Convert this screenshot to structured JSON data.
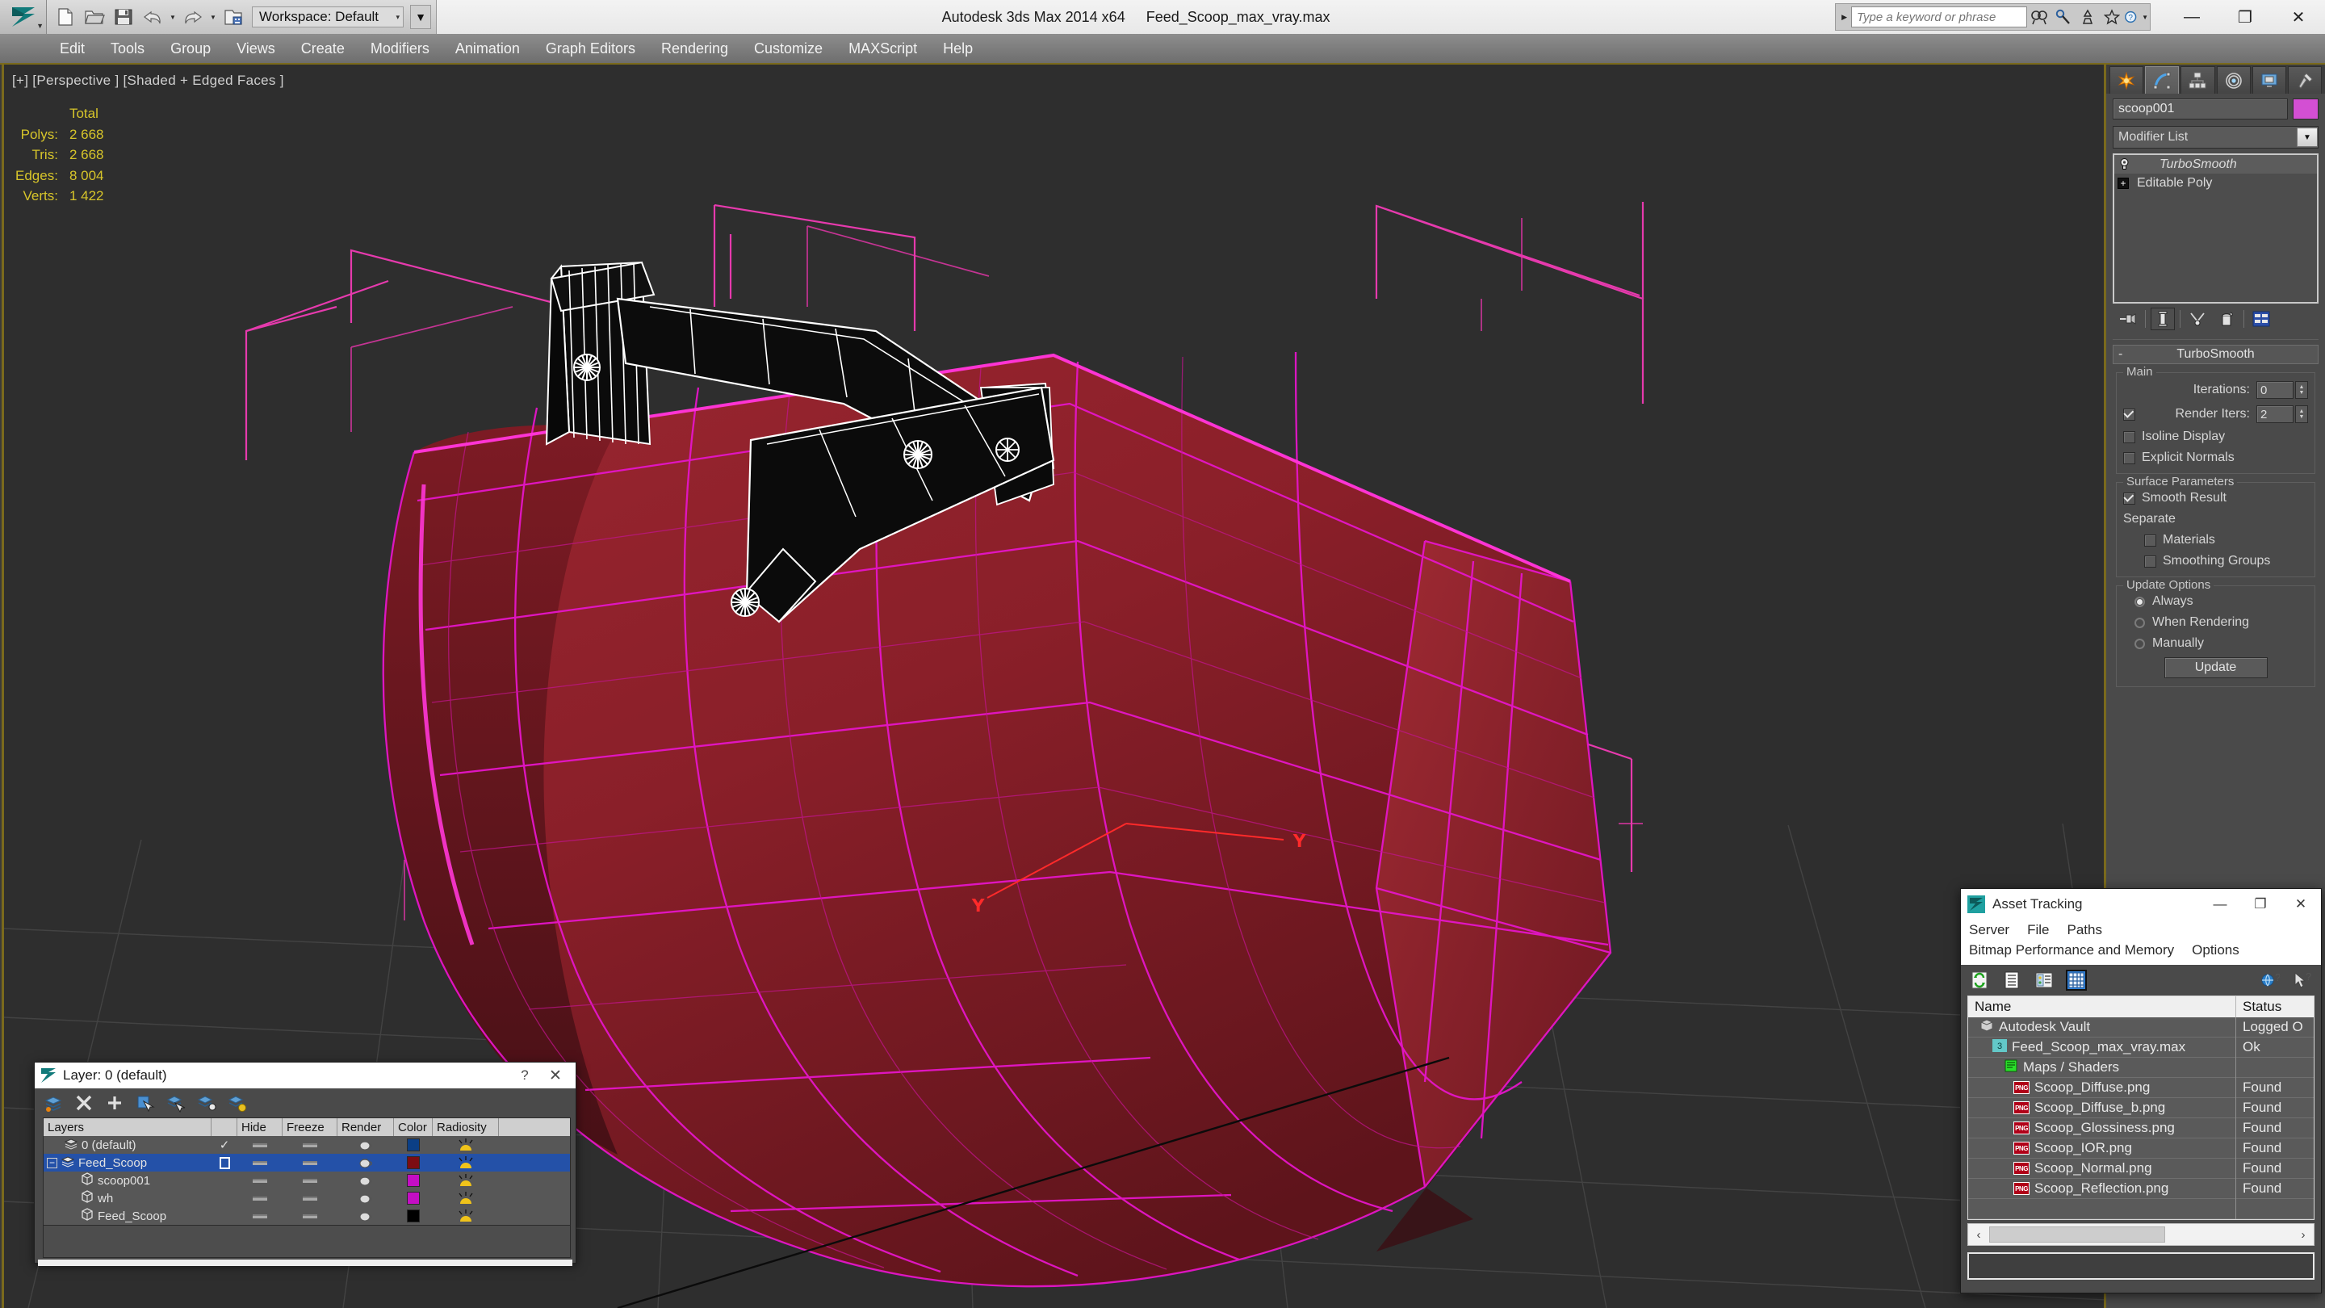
{
  "titlebar": {
    "app_title": "Autodesk 3ds Max  2014 x64",
    "file_title": "Feed_Scoop_max_vray.max",
    "workspace_label": "Workspace: Default",
    "workspace_caret": "▾",
    "qat_more": "▼",
    "quick_access": [
      {
        "name": "new-file-icon",
        "label": "New"
      },
      {
        "name": "open-file-icon",
        "label": "Open"
      },
      {
        "name": "save-file-icon",
        "label": "Save"
      },
      {
        "name": "undo-icon",
        "label": "Undo"
      },
      {
        "name": "redo-icon",
        "label": "Redo"
      },
      {
        "name": "set-project-folder-icon",
        "label": "Set Project Folder"
      }
    ],
    "search_placeholder": "Type a keyword or phrase",
    "infocenter_icons": [
      "search-icon",
      "subscription-center-icon",
      "communication-center-icon",
      "favorites-icon",
      "help-icon"
    ],
    "window_controls": {
      "minimize": "—",
      "maximize": "❐",
      "close": "✕"
    }
  },
  "menubar": {
    "items": [
      "Edit",
      "Tools",
      "Group",
      "Views",
      "Create",
      "Modifiers",
      "Animation",
      "Graph Editors",
      "Rendering",
      "Customize",
      "MAXScript",
      "Help"
    ]
  },
  "viewport": {
    "label": "[+] [Perspective ] [Shaded + Edged Faces ]",
    "stats_header": "Total",
    "stats": [
      {
        "label": "Polys:",
        "value": "2 668"
      },
      {
        "label": "Tris:",
        "value": "2 668"
      },
      {
        "label": "Edges:",
        "value": "8 004"
      },
      {
        "label": "Verts:",
        "value": "1 422"
      }
    ],
    "colors": {
      "background": "#2e2e2e",
      "mesh_fill": "#8c1f28",
      "mesh_edge": "#e614c8",
      "selection_bracket": "#ff2fbd",
      "gizmo_x": "#ff2020",
      "grid": "#4a4a4a",
      "wire_white": "#ffffff",
      "stats_text": "#d7c52a"
    }
  },
  "command_panel": {
    "tabs": [
      {
        "name": "create-tab",
        "icon": "star-icon",
        "active": false
      },
      {
        "name": "modify-tab",
        "icon": "curve-icon",
        "active": true
      },
      {
        "name": "hierarchy-tab",
        "icon": "hierarchy-icon",
        "active": false
      },
      {
        "name": "motion-tab",
        "icon": "motion-icon",
        "active": false
      },
      {
        "name": "display-tab",
        "icon": "display-icon",
        "active": false
      },
      {
        "name": "utilities-tab",
        "icon": "hammer-icon",
        "active": false
      }
    ],
    "object_name": "scoop001",
    "object_color": "#d34fd3",
    "modifier_list_label": "Modifier List",
    "stack": [
      {
        "label": "TurboSmooth",
        "selected": true,
        "italic": true
      },
      {
        "label": "Editable Poly",
        "selected": false,
        "italic": false
      }
    ],
    "stack_buttons": [
      {
        "name": "pin-stack-button",
        "icon": "pin-icon",
        "active": false
      },
      {
        "name": "show-end-result-button",
        "icon": "show-end-result-icon",
        "active": true
      },
      {
        "name": "make-unique-button",
        "icon": "make-unique-icon",
        "active": false
      },
      {
        "name": "remove-modifier-button",
        "icon": "trash-icon",
        "active": false
      },
      {
        "name": "configure-modifier-sets-button",
        "icon": "configure-sets-icon",
        "active": false
      }
    ],
    "rollout": {
      "title": "TurboSmooth",
      "collapse_glyph": "-",
      "main_group": "Main",
      "iterations_label": "Iterations:",
      "iterations_value": "0",
      "render_iters_label": "Render Iters:",
      "render_iters_value": "2",
      "render_iters_checked": true,
      "isoline_label": "Isoline Display",
      "isoline_checked": false,
      "explicit_normals_label": "Explicit Normals",
      "explicit_normals_checked": false,
      "surface_group": "Surface Parameters",
      "smooth_result_label": "Smooth Result",
      "smooth_result_checked": true,
      "separate_label": "Separate",
      "materials_label": "Materials",
      "materials_checked": false,
      "smoothing_groups_label": "Smoothing Groups",
      "smoothing_groups_checked": false,
      "update_group": "Update Options",
      "update_always": "Always",
      "update_when_rendering": "When Rendering",
      "update_manually": "Manually",
      "update_selected": "Always",
      "update_button": "Update"
    }
  },
  "layer_dialog": {
    "title": "Layer: 0 (default)",
    "help_glyph": "?",
    "close_glyph": "✕",
    "toolbar": [
      {
        "name": "create-new-layer-button",
        "icon": "new-layer-icon"
      },
      {
        "name": "delete-layer-button",
        "icon": "delete-x-icon"
      },
      {
        "name": "add-selection-button",
        "icon": "plus-icon"
      },
      {
        "name": "select-objects-in-layer-button",
        "icon": "select-objects-icon"
      },
      {
        "name": "select-highlighted-button",
        "icon": "select-highlighted-icon"
      },
      {
        "name": "highlight-selected-button",
        "icon": "highlight-selected-icon"
      },
      {
        "name": "layer-properties-button",
        "icon": "layer-properties-icon"
      }
    ],
    "columns": [
      "Layers",
      "",
      "Hide",
      "Freeze",
      "Render",
      "Color",
      "Radiosity",
      ""
    ],
    "rows": [
      {
        "name": "0 (default)",
        "type": "layer",
        "indent": 1,
        "current": true,
        "selected": false,
        "hide": "dash",
        "freeze": "dash",
        "render": "teapot",
        "color": "#0b3f86",
        "radiosity": "lamp"
      },
      {
        "name": "Feed_Scoop",
        "type": "layer",
        "indent": 0,
        "current": false,
        "selected": true,
        "expand": "-",
        "hide": "dash",
        "freeze": "dash",
        "render": "teapot",
        "color": "#7c0d12",
        "radiosity": "lamp"
      },
      {
        "name": "scoop001",
        "type": "object",
        "indent": 2,
        "current": false,
        "selected": false,
        "hide": "dash",
        "freeze": "dash",
        "render": "teapot",
        "color": "#c40ec4",
        "radiosity": "lamp"
      },
      {
        "name": "wh",
        "type": "object",
        "indent": 2,
        "current": false,
        "selected": false,
        "hide": "dash",
        "freeze": "dash",
        "render": "teapot",
        "color": "#c40ec4",
        "radiosity": "lamp"
      },
      {
        "name": "Feed_Scoop",
        "type": "object",
        "indent": 2,
        "current": false,
        "selected": false,
        "hide": "dash",
        "freeze": "dash",
        "render": "teapot",
        "color": "#000000",
        "radiosity": "lamp"
      }
    ]
  },
  "asset_tracking": {
    "title": "Asset Tracking",
    "window_controls": {
      "minimize": "—",
      "maximize": "❐",
      "close": "✕"
    },
    "menus_row1": [
      "Server",
      "File",
      "Paths"
    ],
    "menus_row2": [
      "Bitmap Performance and Memory",
      "Options"
    ],
    "toolbar": [
      {
        "name": "refresh-button",
        "icon": "refresh-icon",
        "active": false
      },
      {
        "name": "list-view-button",
        "icon": "list-icon",
        "active": false
      },
      {
        "name": "detail-view-button",
        "icon": "detail-icon",
        "active": false
      },
      {
        "name": "grid-view-button",
        "icon": "grid-icon",
        "active": true
      }
    ],
    "toolbar_right": [
      {
        "name": "whats-this-globe-button",
        "icon": "globe-help-icon"
      },
      {
        "name": "context-help-button",
        "icon": "cursor-help-icon"
      }
    ],
    "columns": [
      "Name",
      "Status"
    ],
    "rows": [
      {
        "name": "Autodesk Vault",
        "status": "Logged O",
        "indent": 1,
        "icon": "vault-icon"
      },
      {
        "name": "Feed_Scoop_max_vray.max",
        "status": "Ok",
        "indent": 2,
        "icon": "max-file-icon"
      },
      {
        "name": "Maps / Shaders",
        "status": "",
        "indent": 3,
        "icon": "maps-shaders-icon"
      },
      {
        "name": "Scoop_Diffuse.png",
        "status": "Found",
        "indent": 4,
        "icon": "png-icon"
      },
      {
        "name": "Scoop_Diffuse_b.png",
        "status": "Found",
        "indent": 4,
        "icon": "png-icon"
      },
      {
        "name": "Scoop_Glossiness.png",
        "status": "Found",
        "indent": 4,
        "icon": "png-icon"
      },
      {
        "name": "Scoop_IOR.png",
        "status": "Found",
        "indent": 4,
        "icon": "png-icon"
      },
      {
        "name": "Scoop_Normal.png",
        "status": "Found",
        "indent": 4,
        "icon": "png-icon"
      },
      {
        "name": "Scoop_Reflection.png",
        "status": "Found",
        "indent": 4,
        "icon": "png-icon"
      }
    ],
    "scroll_left": "‹",
    "scroll_right": "›"
  }
}
